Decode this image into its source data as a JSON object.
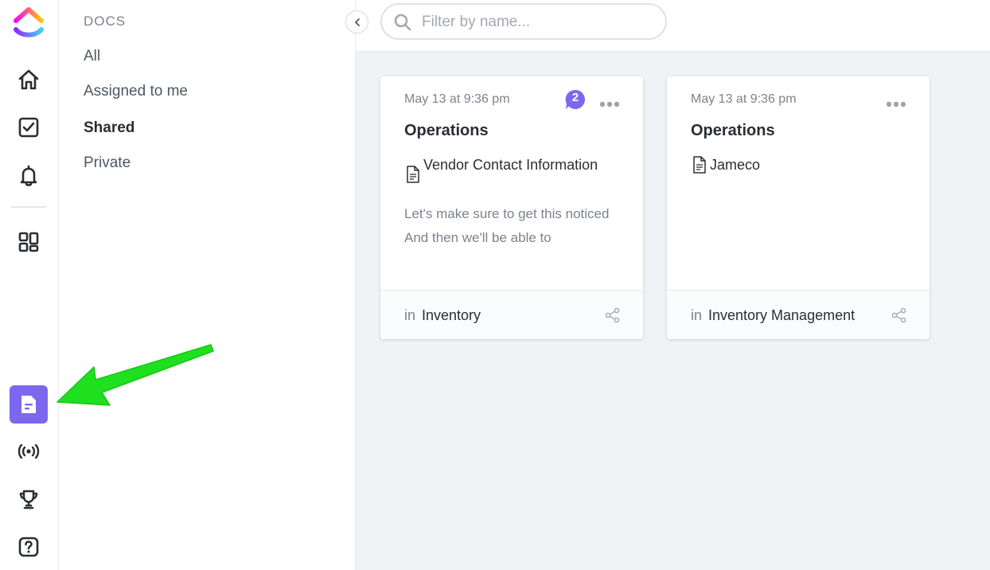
{
  "rail": {
    "icons": [
      "logo",
      "home-icon",
      "tasks-icon",
      "notifications-icon",
      "dashboards-icon",
      "docs-icon",
      "pulse-icon",
      "goals-icon",
      "help-icon"
    ],
    "active": "docs-icon",
    "accent": "#7b68ee"
  },
  "sidebar": {
    "heading": "DOCS",
    "items": [
      {
        "label": "All",
        "active": false
      },
      {
        "label": "Assigned to me",
        "active": false
      },
      {
        "label": "Shared",
        "active": true
      },
      {
        "label": "Private",
        "active": false
      }
    ]
  },
  "search": {
    "placeholder": "Filter by name..."
  },
  "cards": [
    {
      "date": "May 13 at 9:36 pm",
      "comment_count": "2",
      "title": "Operations",
      "doc_name": "Vendor Contact Information",
      "preview": "Let's make sure to get this noticed And then we'll be able to",
      "location_prefix": "in",
      "location": "Inventory"
    },
    {
      "date": "May 13 at 9:36 pm",
      "comment_count": "",
      "title": "Operations",
      "doc_name": "Jameco",
      "preview": "",
      "location_prefix": "in",
      "location": "Inventory Management"
    }
  ],
  "annotation": {
    "color": "#1ee01e"
  }
}
